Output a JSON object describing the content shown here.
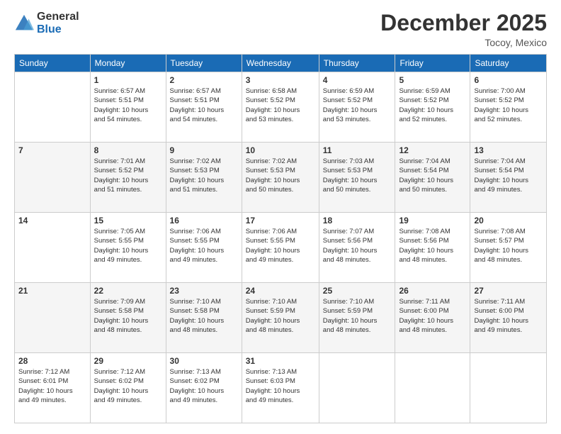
{
  "logo": {
    "general": "General",
    "blue": "Blue"
  },
  "header": {
    "month": "December 2025",
    "location": "Tocoy, Mexico"
  },
  "weekdays": [
    "Sunday",
    "Monday",
    "Tuesday",
    "Wednesday",
    "Thursday",
    "Friday",
    "Saturday"
  ],
  "weeks": [
    [
      {
        "day": "",
        "info": ""
      },
      {
        "day": "1",
        "info": "Sunrise: 6:57 AM\nSunset: 5:51 PM\nDaylight: 10 hours\nand 54 minutes."
      },
      {
        "day": "2",
        "info": "Sunrise: 6:57 AM\nSunset: 5:51 PM\nDaylight: 10 hours\nand 54 minutes."
      },
      {
        "day": "3",
        "info": "Sunrise: 6:58 AM\nSunset: 5:52 PM\nDaylight: 10 hours\nand 53 minutes."
      },
      {
        "day": "4",
        "info": "Sunrise: 6:59 AM\nSunset: 5:52 PM\nDaylight: 10 hours\nand 53 minutes."
      },
      {
        "day": "5",
        "info": "Sunrise: 6:59 AM\nSunset: 5:52 PM\nDaylight: 10 hours\nand 52 minutes."
      },
      {
        "day": "6",
        "info": "Sunrise: 7:00 AM\nSunset: 5:52 PM\nDaylight: 10 hours\nand 52 minutes."
      }
    ],
    [
      {
        "day": "7",
        "info": ""
      },
      {
        "day": "8",
        "info": "Sunrise: 7:01 AM\nSunset: 5:52 PM\nDaylight: 10 hours\nand 51 minutes."
      },
      {
        "day": "9",
        "info": "Sunrise: 7:02 AM\nSunset: 5:53 PM\nDaylight: 10 hours\nand 51 minutes."
      },
      {
        "day": "10",
        "info": "Sunrise: 7:02 AM\nSunset: 5:53 PM\nDaylight: 10 hours\nand 50 minutes."
      },
      {
        "day": "11",
        "info": "Sunrise: 7:03 AM\nSunset: 5:53 PM\nDaylight: 10 hours\nand 50 minutes."
      },
      {
        "day": "12",
        "info": "Sunrise: 7:04 AM\nSunset: 5:54 PM\nDaylight: 10 hours\nand 50 minutes."
      },
      {
        "day": "13",
        "info": "Sunrise: 7:04 AM\nSunset: 5:54 PM\nDaylight: 10 hours\nand 49 minutes."
      }
    ],
    [
      {
        "day": "14",
        "info": ""
      },
      {
        "day": "15",
        "info": "Sunrise: 7:05 AM\nSunset: 5:55 PM\nDaylight: 10 hours\nand 49 minutes."
      },
      {
        "day": "16",
        "info": "Sunrise: 7:06 AM\nSunset: 5:55 PM\nDaylight: 10 hours\nand 49 minutes."
      },
      {
        "day": "17",
        "info": "Sunrise: 7:06 AM\nSunset: 5:55 PM\nDaylight: 10 hours\nand 49 minutes."
      },
      {
        "day": "18",
        "info": "Sunrise: 7:07 AM\nSunset: 5:56 PM\nDaylight: 10 hours\nand 48 minutes."
      },
      {
        "day": "19",
        "info": "Sunrise: 7:08 AM\nSunset: 5:56 PM\nDaylight: 10 hours\nand 48 minutes."
      },
      {
        "day": "20",
        "info": "Sunrise: 7:08 AM\nSunset: 5:57 PM\nDaylight: 10 hours\nand 48 minutes."
      }
    ],
    [
      {
        "day": "21",
        "info": ""
      },
      {
        "day": "22",
        "info": "Sunrise: 7:09 AM\nSunset: 5:58 PM\nDaylight: 10 hours\nand 48 minutes."
      },
      {
        "day": "23",
        "info": "Sunrise: 7:10 AM\nSunset: 5:58 PM\nDaylight: 10 hours\nand 48 minutes."
      },
      {
        "day": "24",
        "info": "Sunrise: 7:10 AM\nSunset: 5:59 PM\nDaylight: 10 hours\nand 48 minutes."
      },
      {
        "day": "25",
        "info": "Sunrise: 7:10 AM\nSunset: 5:59 PM\nDaylight: 10 hours\nand 48 minutes."
      },
      {
        "day": "26",
        "info": "Sunrise: 7:11 AM\nSunset: 6:00 PM\nDaylight: 10 hours\nand 48 minutes."
      },
      {
        "day": "27",
        "info": "Sunrise: 7:11 AM\nSunset: 6:00 PM\nDaylight: 10 hours\nand 49 minutes."
      }
    ],
    [
      {
        "day": "28",
        "info": "Sunrise: 7:12 AM\nSunset: 6:01 PM\nDaylight: 10 hours\nand 49 minutes."
      },
      {
        "day": "29",
        "info": "Sunrise: 7:12 AM\nSunset: 6:02 PM\nDaylight: 10 hours\nand 49 minutes."
      },
      {
        "day": "30",
        "info": "Sunrise: 7:13 AM\nSunset: 6:02 PM\nDaylight: 10 hours\nand 49 minutes."
      },
      {
        "day": "31",
        "info": "Sunrise: 7:13 AM\nSunset: 6:03 PM\nDaylight: 10 hours\nand 49 minutes."
      },
      {
        "day": "",
        "info": ""
      },
      {
        "day": "",
        "info": ""
      },
      {
        "day": "",
        "info": ""
      }
    ]
  ]
}
